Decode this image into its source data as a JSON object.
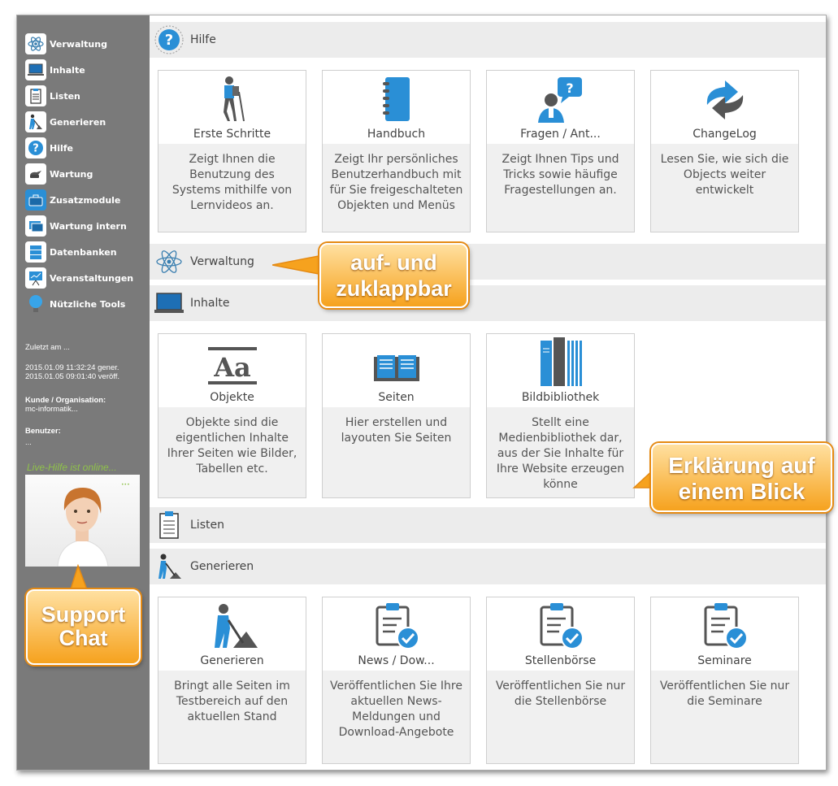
{
  "sidebar": {
    "items": [
      {
        "label": "Verwaltung",
        "icon": "atom-icon"
      },
      {
        "label": "Inhalte",
        "icon": "monitor-icon"
      },
      {
        "label": "Listen",
        "icon": "clipboard-icon"
      },
      {
        "label": "Generieren",
        "icon": "worker-shovel-icon"
      },
      {
        "label": "Hilfe",
        "icon": "help-icon"
      },
      {
        "label": "Wartung",
        "icon": "oilcan-icon"
      },
      {
        "label": "Zusatzmodule",
        "icon": "briefcase-icon"
      },
      {
        "label": "Wartung intern",
        "icon": "cards-icon"
      },
      {
        "label": "Datenbanken",
        "icon": "database-icon"
      },
      {
        "label": "Veranstaltungen",
        "icon": "presentation-icon"
      },
      {
        "label": "Nützliche Tools",
        "icon": "lightbulb-icon"
      }
    ],
    "last_label": "Zuletzt am ...",
    "date_gener": "2015.01.09 11:32:24 gener.",
    "date_veroeff": "2015.01.05 09:01:40 veröff.",
    "customer_label": "Kunde / Organisation:",
    "customer_value": "mc-informatik...",
    "user_label": "Benutzer:",
    "user_value": "...",
    "live_help": "Live-Hilfe ist online..."
  },
  "sections": {
    "hilfe": "Hilfe",
    "verwaltung": "Verwaltung",
    "inhalte": "Inhalte",
    "listen": "Listen",
    "generieren": "Generieren"
  },
  "tiles": {
    "hilfe": [
      {
        "title": "Erste Schritte",
        "desc": "Zeigt Ihnen die Benutzung des Systems mithilfe von Lernvideos an."
      },
      {
        "title": "Handbuch",
        "desc": "Zeigt Ihr persönliches Benutzerhandbuch mit für Sie freigeschalteten Objekten und Menüs"
      },
      {
        "title": "Fragen / Ant...",
        "desc": "Zeigt Ihnen Tips und Tricks sowie häufige Fragestellungen an."
      },
      {
        "title": "ChangeLog",
        "desc": "Lesen Sie, wie sich die Objects weiter entwickelt"
      }
    ],
    "inhalte": [
      {
        "title": "Objekte",
        "desc": "Objekte sind die eigentlichen Inhalte Ihrer Seiten wie Bilder, Tabellen etc."
      },
      {
        "title": "Seiten",
        "desc": "Hier erstellen und layouten Sie Seiten"
      },
      {
        "title": "Bildbibliothek",
        "desc": "Stellt eine Medienbibliothek dar, aus der Sie Inhalte für Ihre Website erzeugen könne"
      }
    ],
    "generieren": [
      {
        "title": "Generieren",
        "desc": "Bringt alle Seiten im Testbereich auf den aktuellen Stand"
      },
      {
        "title": "News / Dow...",
        "desc": "Veröffentlichen Sie Ihre aktuellen News-Meldungen und Download-Angebote"
      },
      {
        "title": "Stellenbörse",
        "desc": "Veröffentlichen Sie nur die Stellenbörse"
      },
      {
        "title": "Seminare",
        "desc": "Veröffentlichen Sie nur die Seminare"
      }
    ]
  },
  "callouts": {
    "collapsible_line1": "auf- und",
    "collapsible_line2": "zuklappbar",
    "overview_line1": "Erklärung auf",
    "overview_line2": "einem Blick",
    "support_line1": "Support",
    "support_line2": "Chat"
  },
  "colors": {
    "sidebar_bg": "#7a7a7a",
    "accent_blue": "#2a8fd6",
    "section_bg": "#ececec",
    "callout_orange": "#f6a21e",
    "live_green": "#8fc24a"
  }
}
